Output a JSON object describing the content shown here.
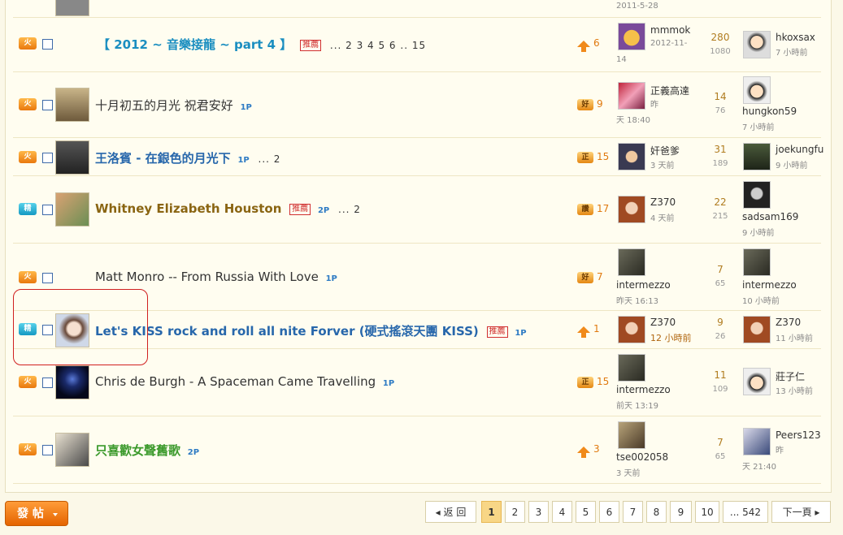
{
  "top_remnant": {
    "time": "2011-5-28"
  },
  "rows": [
    {
      "badge": "火",
      "title": "【 2012 ~ 音樂接龍 ~ part 4 】",
      "rec": "推薦",
      "pages": "... 2  3  4  5  6 .. 15",
      "vote_icon": "arrow",
      "vote": "6",
      "author": "mmmok",
      "author_time_a": "2012-11-",
      "author_time_b": "14",
      "replies": "280",
      "views": "1080",
      "last_user": "hkoxsax",
      "last_time": "7 小時前"
    },
    {
      "badge": "火",
      "title": "十月初五的月光 祝君安好",
      "p": "1P",
      "vote_icon": "好",
      "vote": "9",
      "author": "正義高達",
      "author_time_a": "昨",
      "author_time_b": "天 18:40",
      "replies": "14",
      "views": "76",
      "last_user": "hungkon59",
      "last_time": "7 小時前"
    },
    {
      "badge": "火",
      "title": "王洛賓 - 在銀色的月光下",
      "p": "1P",
      "pages": "... 2",
      "vote_icon": "正",
      "vote": "15",
      "author": "奸爸爹",
      "author_time_a": "3 天前",
      "replies": "31",
      "views": "189",
      "last_user": "joekungfu",
      "last_time": "9 小時前"
    },
    {
      "badge": "精",
      "title": "Whitney Elizabeth Houston",
      "rec": "推薦",
      "p": "2P",
      "pages": "... 2",
      "vote_icon": "讚",
      "vote": "17",
      "author": "Z370",
      "author_time_a": "4 天前",
      "replies": "22",
      "views": "215",
      "last_user": "sadsam169",
      "last_time": "9 小時前"
    },
    {
      "badge": "火",
      "title": "Matt Monro -- From Russia With Love",
      "p": "1P",
      "vote_icon": "好",
      "vote": "7",
      "author": "intermezzo",
      "author_time_a": "昨天 16:13",
      "replies": "7",
      "views": "65",
      "last_user": "intermezzo",
      "last_time": "10 小時前"
    },
    {
      "badge": "精",
      "title": "Let's KISS rock and roll all nite Forver (硬式搖滾天團 KISS)",
      "rec": "推薦",
      "p": "1P",
      "vote_icon": "arrow",
      "vote": "1",
      "author": "Z370",
      "author_time_a": "12 小時前",
      "replies": "9",
      "views": "26",
      "last_user": "Z370",
      "last_time": "11 小時前"
    },
    {
      "badge": "火",
      "title": "Chris de Burgh - A Spaceman Came Travelling",
      "p": "1P",
      "vote_icon": "正",
      "vote": "15",
      "author": "intermezzo",
      "author_time_a": "前天 13:19",
      "replies": "11",
      "views": "109",
      "last_user": "莊子仁",
      "last_time": "13 小時前"
    },
    {
      "badge": "火",
      "title": "只喜歡女聲舊歌",
      "p": "2P",
      "vote_icon": "arrow",
      "vote": "3",
      "author": "tse002058",
      "author_time_a": "3 天前",
      "replies": "7",
      "views": "65",
      "last_user": "Peers123",
      "last_time_a": "昨",
      "last_time_b": "天 21:40"
    }
  ],
  "footer": {
    "post_button": "發 帖",
    "prev": "◂ 返 回",
    "pages": [
      "1",
      "2",
      "3",
      "4",
      "5",
      "6",
      "7",
      "8",
      "9",
      "10",
      "... 542"
    ],
    "next": "下一頁 ▸"
  }
}
